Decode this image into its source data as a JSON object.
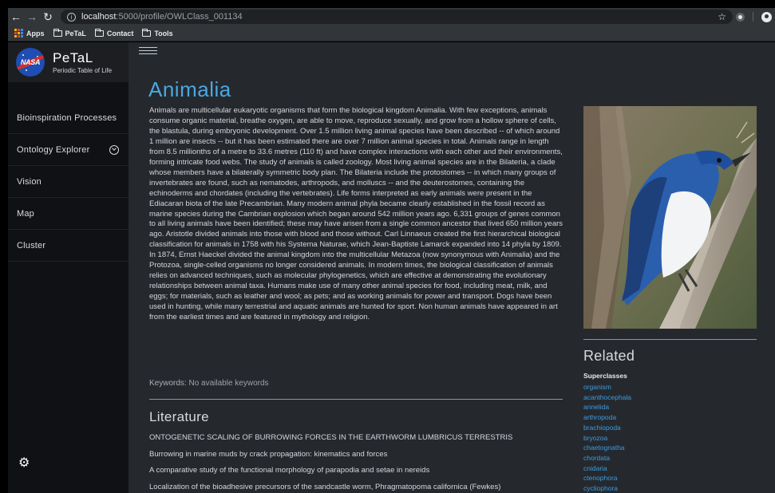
{
  "browser": {
    "url_host": "localhost",
    "url_path": ":5000/profile/OWLClass_001134",
    "bookmarks": [
      "Apps",
      "PeTaL",
      "Contact",
      "Tools"
    ]
  },
  "icons": {
    "back": "back-arrow-icon",
    "forward": "forward-arrow-icon",
    "reload": "reload-icon",
    "star": "star-icon",
    "settings": "gear-icon",
    "menu": "hamburger-icon"
  },
  "colors": {
    "title_blue": "#4aa8e0",
    "link_blue": "#3d9be0",
    "main_bg": "#25292e",
    "sidebar_bg": "#0f1114"
  },
  "brand": {
    "logo_text": "NASA",
    "title": "PeTaL",
    "subtitle": "Periodic Table of Life"
  },
  "nav": {
    "items": [
      {
        "label": "Bioinspiration Processes"
      },
      {
        "label": "Ontology Explorer"
      },
      {
        "label": "Vision"
      },
      {
        "label": "Map"
      },
      {
        "label": "Cluster"
      }
    ]
  },
  "main": {
    "title": "Animalia",
    "description": "Animals are multicellular eukaryotic organisms that form the biological kingdom Animalia. With few exceptions, animals consume organic material, breathe oxygen, are able to move, reproduce sexually, and grow from a hollow sphere of cells, the blastula, during embryonic development. Over 1.5 million living animal species have been described -- of which around 1 million are insects -- but it has been estimated there are over 7 million animal species in total. Animals range in length from 8.5 millionths of a metre to 33.6 metres (110 ft) and have complex interactions with each other and their environments, forming intricate food webs. The study of animals is called zoology. Most living animal species are in the Bilateria, a clade whose members have a bilaterally symmetric body plan. The Bilateria include the protostomes -- in which many groups of invertebrates are found, such as nematodes, arthropods, and molluscs -- and the deuterostomes, containing the echinoderms and chordates (including the vertebrates). Life forms interpreted as early animals were present in the Ediacaran biota of the late Precambrian. Many modern animal phyla became clearly established in the fossil record as marine species during the Cambrian explosion which began around 542 million years ago. 6,331 groups of genes common to all living animals have been identified; these may have arisen from a single common ancestor that lived 650 million years ago. Aristotle divided animals into those with blood and those without. Carl Linnaeus created the first hierarchical biological classification for animals in 1758 with his Systema Naturae, which Jean-Baptiste Lamarck expanded into 14 phyla by 1809. In 1874, Ernst Haeckel divided the animal kingdom into the multicellular Metazoa (now synonymous with Animalia) and the Protozoa, single-celled organisms no longer considered animals. In modern times, the biological classification of animals relies on advanced techniques, such as molecular phylogenetics, which are effective at demonstrating the evolutionary relationships between animal taxa. Humans make use of many other animal species for food, including meat, milk, and eggs; for materials, such as leather and wool; as pets; and as working animals for power and transport. Dogs have been used in hunting, while many terrestrial and aquatic animals are hunted for sport. Non human animals have appeared in art from the earliest times and are featured in mythology and religion.",
    "keywords_label": "Keywords:",
    "keywords_value": "No available keywords",
    "literature_title": "Literature",
    "literature": [
      "ONTOGENETIC SCALING OF BURROWING FORCES IN THE EARTHWORM LUMBRICUS TERRESTRIS",
      "Burrowing in marine muds by crack propagation: kinematics and forces",
      "A comparative study of the functional morphology of parapodia and setae in nereids",
      "Localization of the bioadhesive precursors of the sandcastle worm, Phragmatopoma californica (Fewkes)"
    ]
  },
  "related": {
    "title": "Related",
    "superclasses_label": "Superclasses",
    "items": [
      "organism",
      "acanthocephala",
      "annelida",
      "arthropoda",
      "brachiopoda",
      "bryozoa",
      "chaetognatha",
      "chordata",
      "cnidaria",
      "ctenophora",
      "cycliophora"
    ]
  }
}
